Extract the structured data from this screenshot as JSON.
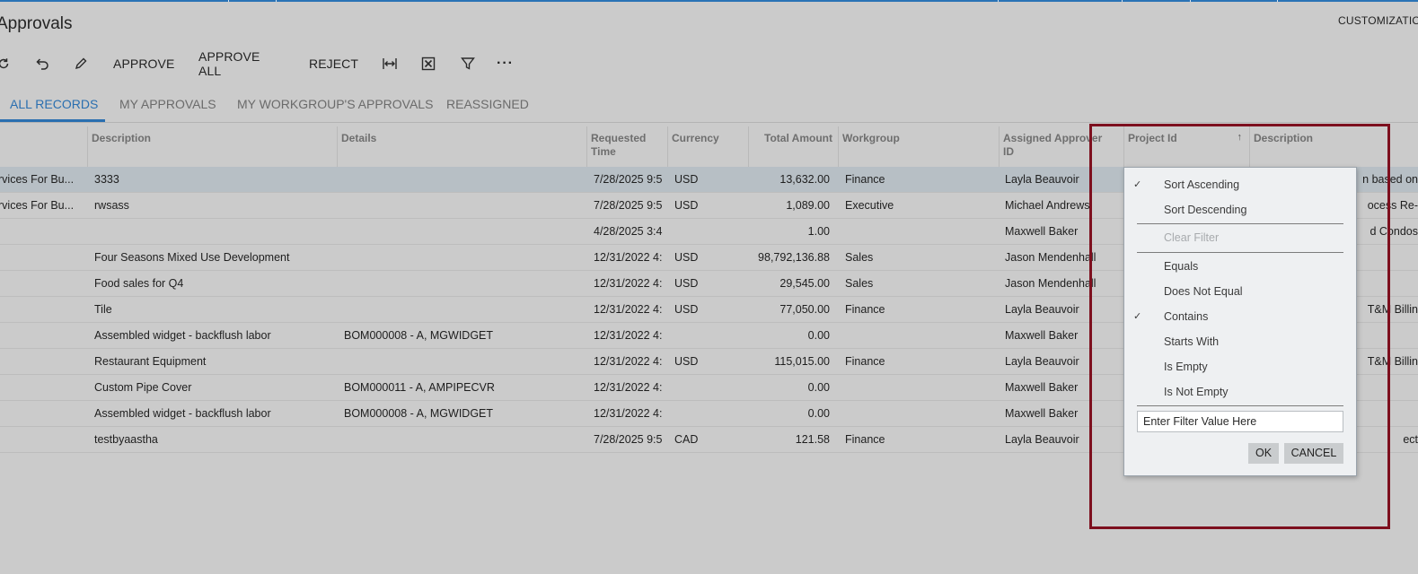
{
  "app": {
    "title": "Approvals",
    "customization_label": "CUSTOMIZATION"
  },
  "toolbar": {
    "refresh_icon": "refresh-icon",
    "undo_icon": "undo-icon",
    "edit_icon": "pencil-icon",
    "approve_label": "APPROVE",
    "approve_all_label": "APPROVE ALL",
    "reject_label": "REJECT",
    "fit_icon": "fit-columns-icon",
    "excel_icon": "export-excel-icon",
    "filter_icon": "filter-icon",
    "more_label": "···"
  },
  "tabs": [
    {
      "label": "ALL RECORDS",
      "active": true
    },
    {
      "label": "MY APPROVALS",
      "active": false
    },
    {
      "label": "MY WORKGROUP'S APPROVALS",
      "active": false
    },
    {
      "label": "REASSIGNED",
      "active": false
    }
  ],
  "grid": {
    "headers": {
      "description": "Description",
      "details": "Details",
      "requested_time_1": "Requested",
      "requested_time_2": "Time",
      "currency": "Currency",
      "total_amount": "Total Amount",
      "workgroup": "Workgroup",
      "assigned_approver_1": "Assigned Approver",
      "assigned_approver_2": "ID",
      "project_id": "Project Id",
      "description2": "Description"
    },
    "sort_indicator": "↑",
    "rows": [
      {
        "type": "rvices For Bu...",
        "description": "3333",
        "details": "",
        "requested": "7/28/2025 9:5",
        "currency": "USD",
        "amount": "13,632.00",
        "workgroup": "Finance",
        "approver": "Layla Beauvoir",
        "desc2": "n based on",
        "selected": true
      },
      {
        "type": "rvices For Bu...",
        "description": "rwsass",
        "details": "",
        "requested": "7/28/2025 9:5",
        "currency": "USD",
        "amount": "1,089.00",
        "workgroup": "Executive",
        "approver": "Michael Andrews",
        "desc2": "ocess Re-",
        "selected": false
      },
      {
        "type": "",
        "description": "",
        "details": "",
        "requested": "4/28/2025 3:4",
        "currency": "",
        "amount": "1.00",
        "workgroup": "",
        "approver": "Maxwell Baker",
        "desc2": "d Condos",
        "selected": false
      },
      {
        "type": "",
        "description": "Four Seasons Mixed Use Development",
        "details": "",
        "requested": "12/31/2022 4:",
        "currency": "USD",
        "amount": "98,792,136.88",
        "workgroup": "Sales",
        "approver": "Jason Mendenhall",
        "desc2": "",
        "selected": false
      },
      {
        "type": "",
        "description": "Food sales for Q4",
        "details": "",
        "requested": "12/31/2022 4:",
        "currency": "USD",
        "amount": "29,545.00",
        "workgroup": "Sales",
        "approver": "Jason Mendenhall",
        "desc2": "",
        "selected": false
      },
      {
        "type": "",
        "description": "Tile",
        "details": "",
        "requested": "12/31/2022 4:",
        "currency": "USD",
        "amount": "77,050.00",
        "workgroup": "Finance",
        "approver": "Layla Beauvoir",
        "desc2": "T&M Billin",
        "selected": false
      },
      {
        "type": "",
        "description": "Assembled widget - backflush labor",
        "details": "BOM000008 - A, MGWIDGET",
        "requested": "12/31/2022 4:",
        "currency": "",
        "amount": "0.00",
        "workgroup": "",
        "approver": "Maxwell Baker",
        "desc2": "",
        "selected": false
      },
      {
        "type": "",
        "description": "Restaurant Equipment",
        "details": "",
        "requested": "12/31/2022 4:",
        "currency": "USD",
        "amount": "115,015.00",
        "workgroup": "Finance",
        "approver": "Layla Beauvoir",
        "desc2": "T&M Billin",
        "selected": false
      },
      {
        "type": "",
        "description": "Custom Pipe Cover",
        "details": "BOM000011 - A, AMPIPECVR",
        "requested": "12/31/2022 4:",
        "currency": "",
        "amount": "0.00",
        "workgroup": "",
        "approver": "Maxwell Baker",
        "desc2": "",
        "selected": false
      },
      {
        "type": "",
        "description": "Assembled widget - backflush labor",
        "details": "BOM000008 - A, MGWIDGET",
        "requested": "12/31/2022 4:",
        "currency": "",
        "amount": "0.00",
        "workgroup": "",
        "approver": "Maxwell Baker",
        "desc2": "",
        "selected": false
      },
      {
        "type": "",
        "description": "testbyaastha",
        "details": "",
        "requested": "7/28/2025 9:5",
        "currency": "CAD",
        "amount": "121.58",
        "workgroup": "Finance",
        "approver": "Layla Beauvoir",
        "desc2": "ect",
        "selected": false
      }
    ]
  },
  "column_menu": {
    "sort_ascending": {
      "label": "Sort Ascending",
      "checked": true
    },
    "sort_descending": {
      "label": "Sort Descending",
      "checked": false
    },
    "clear_filter": {
      "label": "Clear Filter",
      "enabled": false
    },
    "conditions": [
      {
        "label": "Equals",
        "checked": false
      },
      {
        "label": "Does Not Equal",
        "checked": false
      },
      {
        "label": "Contains",
        "checked": true
      },
      {
        "label": "Starts With",
        "checked": false
      },
      {
        "label": "Is Empty",
        "checked": false
      },
      {
        "label": "Is Not Empty",
        "checked": false
      }
    ],
    "check_mark": "✓",
    "filter_placeholder": "Enter Filter Value Here",
    "ok_label": "OK",
    "cancel_label": "CANCEL"
  },
  "colors": {
    "accent": "#2a6fb0",
    "highlight_border": "#7d0f1e",
    "background": "#cbcbcb",
    "selected_row": "#b7bfc5"
  }
}
